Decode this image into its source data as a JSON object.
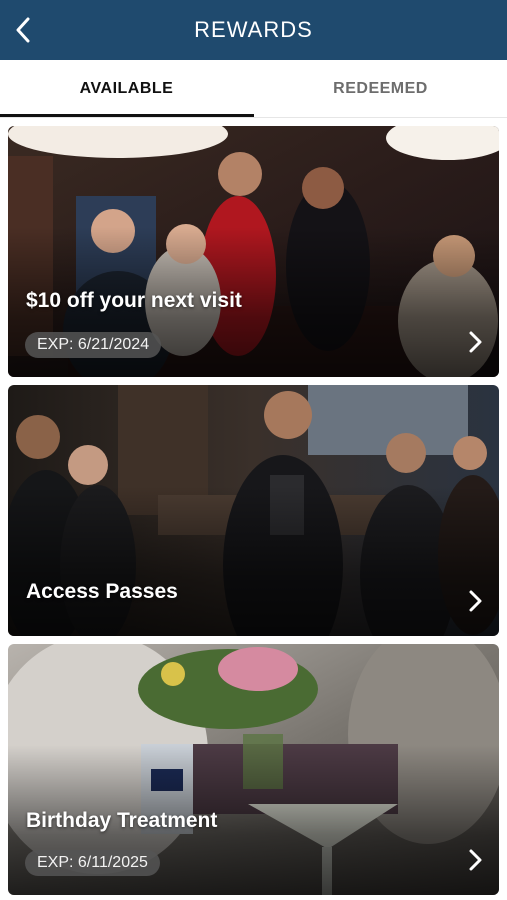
{
  "header": {
    "title": "REWARDS",
    "back_icon": "chevron-left-icon",
    "background": "#1f4a6e"
  },
  "tabs": [
    {
      "label": "AVAILABLE",
      "active": true
    },
    {
      "label": "REDEEMED",
      "active": false
    }
  ],
  "rewards": [
    {
      "title": "$10 off your next visit",
      "expiration": "EXP: 6/21/2024",
      "image": "lounge-performers-photo"
    },
    {
      "title": "Access Passes",
      "image": "bar-crowd-photo"
    },
    {
      "title": "Birthday Treatment",
      "expiration": "EXP: 6/11/2025",
      "image": "cocktail-flowers-photo"
    }
  ]
}
